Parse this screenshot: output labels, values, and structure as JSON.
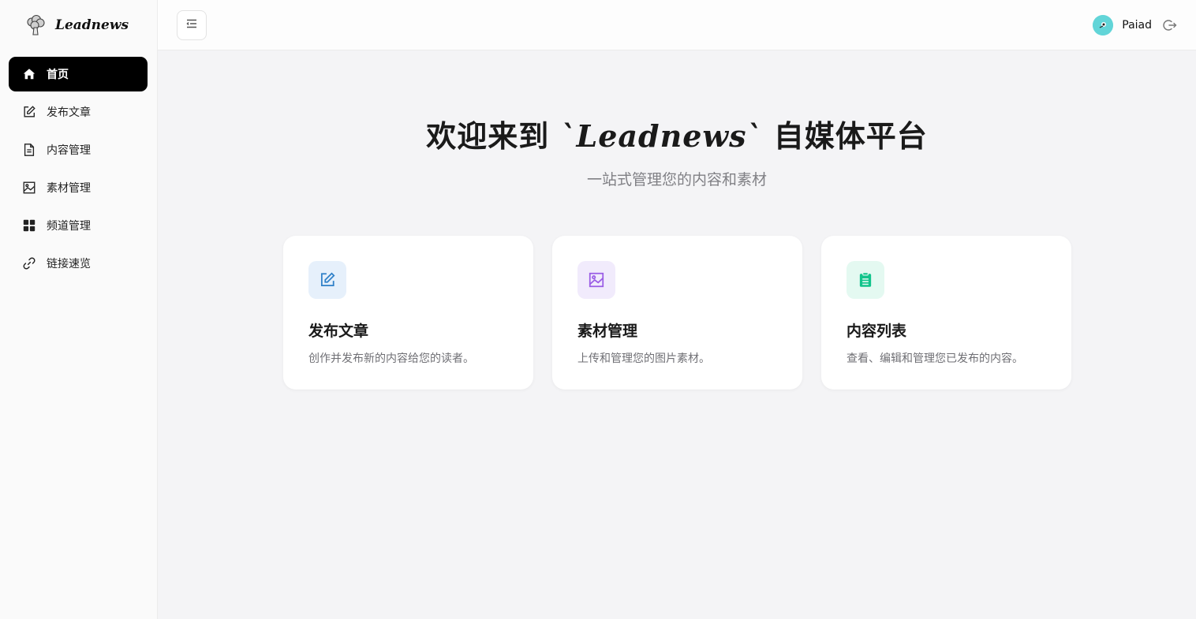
{
  "brand": {
    "name": "Leadnews",
    "logo_icon": "broccoli-logo-icon"
  },
  "sidebar": {
    "items": [
      {
        "label": "首页",
        "icon": "home-icon",
        "active": true
      },
      {
        "label": "发布文章",
        "icon": "edit-icon"
      },
      {
        "label": "内容管理",
        "icon": "document-icon"
      },
      {
        "label": "素材管理",
        "icon": "image-icon"
      },
      {
        "label": "频道管理",
        "icon": "grid-icon"
      },
      {
        "label": "链接速览",
        "icon": "link-icon"
      }
    ]
  },
  "header": {
    "menu_toggle_icon": "menu-collapse-icon",
    "user": {
      "name": "Paiad",
      "avatar_color": "#62d5d8"
    },
    "logout_icon": "logout-icon"
  },
  "hero": {
    "title_prefix": "欢迎来到 ",
    "title_brand": "`Leadnews`",
    "title_suffix": " 自媒体平台",
    "subtitle": "一站式管理您的内容和素材"
  },
  "cards": [
    {
      "title": "发布文章",
      "desc": "创作并发布新的内容给您的读者。",
      "icon": "edit-icon",
      "icon_color": "#2f80c8",
      "icon_bg": "#e6f0fb"
    },
    {
      "title": "素材管理",
      "desc": "上传和管理您的图片素材。",
      "icon": "image-icon",
      "icon_color": "#9b5de5",
      "icon_bg": "#f1ebfc"
    },
    {
      "title": "内容列表",
      "desc": "查看、编辑和管理您已发布的内容。",
      "icon": "clipboard-icon",
      "icon_color": "#12c48b",
      "icon_bg": "#e4f9f1"
    }
  ]
}
